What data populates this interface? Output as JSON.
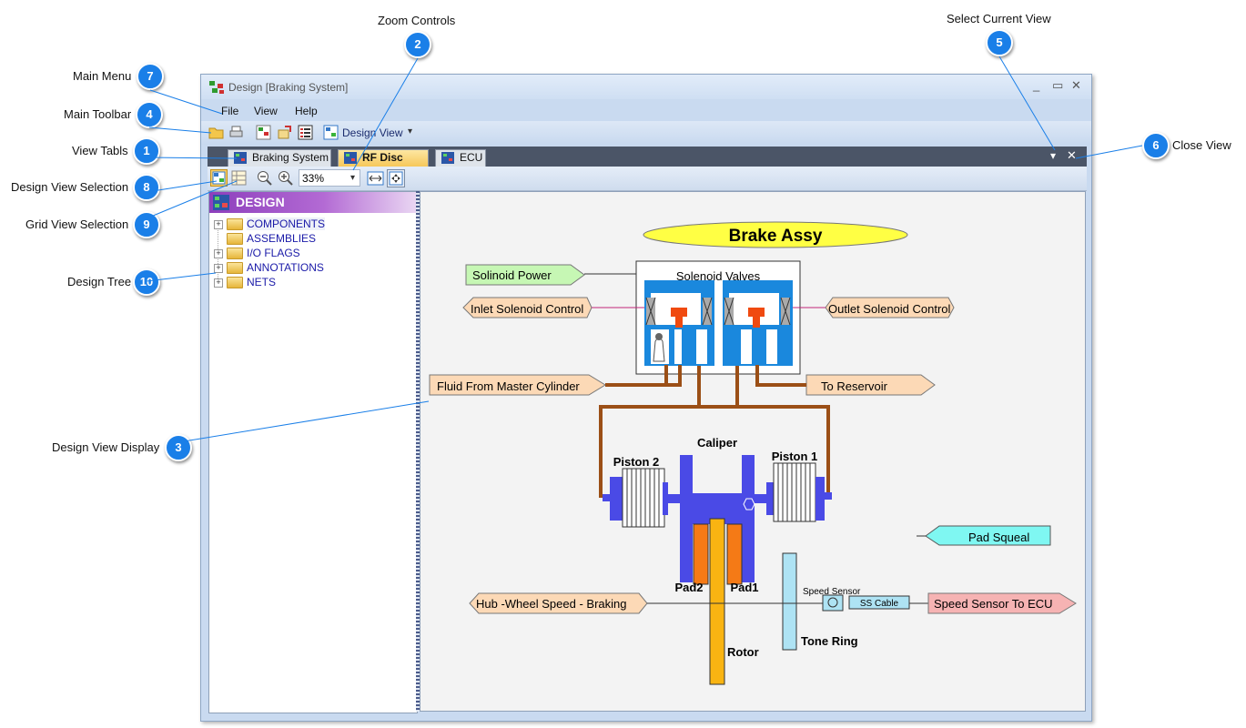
{
  "callouts": {
    "zoom_controls": {
      "label": "Zoom Controls",
      "num": "2"
    },
    "select_view": {
      "label": "Select Current View",
      "num": "5"
    },
    "main_menu": {
      "label": "Main Menu",
      "num": "7"
    },
    "main_toolbar": {
      "label": "Main Toolbar",
      "num": "4"
    },
    "view_tabs": {
      "label": "View Tabls",
      "num": "1"
    },
    "close_view": {
      "label": "Close View",
      "num": "6"
    },
    "design_view_sel": {
      "label": "Design View Selection",
      "num": "8"
    },
    "grid_view_sel": {
      "label": "Grid View Selection",
      "num": "9"
    },
    "design_tree": {
      "label": "Design Tree",
      "num": "10"
    },
    "design_display": {
      "label": "Design View Display",
      "num": "3"
    }
  },
  "window": {
    "title": "Design [Braking System]",
    "min": "_",
    "max": "▭",
    "close": "✕"
  },
  "menu": {
    "file": "File",
    "view": "View",
    "help": "Help"
  },
  "toolbar": {
    "design_view": "Design View",
    "dropdown": "▾"
  },
  "tabs": [
    {
      "label": "Braking System"
    },
    {
      "label": "RF Disc Assy"
    },
    {
      "label": "ECU"
    }
  ],
  "tabstrip": {
    "select_view": "▾",
    "close_view": "✕"
  },
  "view_toolbar": {
    "zoom": "33%",
    "zoom_dropdown": "▾"
  },
  "tree": {
    "header": "DESIGN",
    "items": [
      {
        "label": "COMPONENTS",
        "expand": "+"
      },
      {
        "label": "ASSEMBLIES",
        "expand": ""
      },
      {
        "label": "I/O FLAGS",
        "expand": "+"
      },
      {
        "label": "ANNOTATIONS",
        "expand": "+"
      },
      {
        "label": "NETS",
        "expand": "+"
      }
    ]
  },
  "diagram": {
    "title": "Brake Assy",
    "solenoid_power": "Solinoid Power",
    "solenoid_valves": "Solenoid Valves",
    "inlet_control": "Inlet Solenoid Control",
    "outlet_control": "Outlet Solenoid Control",
    "fluid_from": "Fluid From Master Cylinder",
    "to_reservoir": "To Reservoir",
    "caliper": "Caliper",
    "piston2": "Piston 2",
    "piston1": "Piston 1",
    "pad_squeal": "Pad Squeal",
    "pad2": "Pad2",
    "pad1": "Pad1",
    "speed_sensor": "Speed Sensor",
    "ss_cable": "SS Cable",
    "hub_speed": "Hub -Wheel Speed - Braking",
    "speed_to_ecu": "Speed Sensor To ECU",
    "rotor": "Rotor",
    "tone_ring": "Tone Ring"
  },
  "colors": {
    "badge": "#1a7fe8",
    "title_ellipse": "#ffff44",
    "power_flag": "#c6f7b4",
    "io_flag": "#fcd9b6",
    "squeal_flag": "#7ff7f2",
    "ecu_flag": "#f6b3b3",
    "valve_blue": "#1a88dd",
    "caliper_blue": "#4a4ae6",
    "pad_orange": "#f57a16",
    "rotor_yellow": "#f9b412",
    "tone_ring": "#aee3f4",
    "pipe": "#9b4f16"
  }
}
